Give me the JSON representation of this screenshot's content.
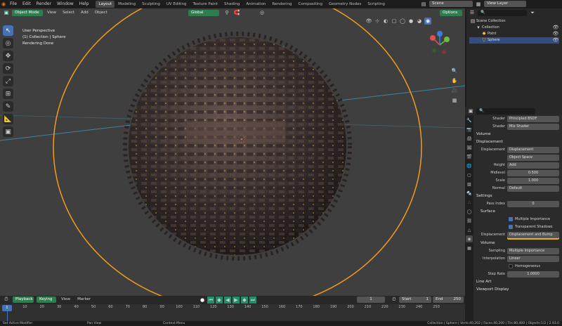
{
  "menubar": {
    "items": [
      "File",
      "Edit",
      "Render",
      "Window",
      "Help"
    ],
    "workspaces": [
      "Layout",
      "Modeling",
      "Sculpting",
      "UV Editing",
      "Texture Paint",
      "Shading",
      "Animation",
      "Rendering",
      "Compositing",
      "Geometry Nodes",
      "Scripting"
    ],
    "active_workspace": "Layout",
    "scene": "Scene",
    "view_layer": "View Layer"
  },
  "viewport_header": {
    "mode": "Object Mode",
    "menus": [
      "View",
      "Select",
      "Add",
      "Object"
    ],
    "transform_orientation": "Global",
    "options": "Options"
  },
  "viewport_info": {
    "line1": "User Perspective",
    "line2": "(1) Collection | Sphere",
    "line3": "Rendering Done"
  },
  "outliner": {
    "rows": [
      {
        "label": "Scene Collection",
        "indent": 0
      },
      {
        "label": "Collection",
        "indent": 1
      },
      {
        "label": "Point",
        "indent": 2
      },
      {
        "label": "Sphere",
        "indent": 2,
        "selected": true
      }
    ]
  },
  "properties": {
    "shader_rows": [
      {
        "label": "Shader",
        "value": "Principled BSDF"
      },
      {
        "label": "Shader",
        "value": "Mix Shader"
      }
    ],
    "volume_label": "Volume",
    "displacement_section": "Displacement",
    "displacement_rows": [
      {
        "label": "Displacement",
        "value": "Displacement",
        "style": "teal"
      },
      {
        "label": "",
        "value": "Object Space",
        "style": "teal"
      },
      {
        "label": "Height",
        "value": "Add",
        "style": "teal"
      },
      {
        "label": "Midlevel",
        "value": "0.500",
        "style": "gray"
      },
      {
        "label": "Scale",
        "value": "1.000",
        "style": "gray"
      },
      {
        "label": "Normal",
        "value": "Default",
        "style": "teal"
      }
    ],
    "settings_section": "Settings",
    "pass_index_label": "Pass Index",
    "pass_index_value": "0",
    "surface_section": "Surface",
    "multiple_importance": "Multiple Importance",
    "transparent_shadows": "Transparent Shadows",
    "surface_displacement_label": "Displacement",
    "surface_displacement_value": "Displacement and Bump",
    "volume_section": "Volume",
    "sampling_label": "Sampling",
    "sampling_value": "Multiple Importance",
    "interpolation_label": "Interpolation",
    "interpolation_value": "Linear",
    "homogeneous": "Homogeneous",
    "step_rate_label": "Step Rate",
    "step_rate_value": "1.0000",
    "line_art": "Line Art",
    "viewport_display": "Viewport Display"
  },
  "timeline": {
    "playback": "Playback",
    "keying": "Keying",
    "view": "View",
    "marker": "Marker",
    "current_frame": "1",
    "start_label": "Start",
    "start_value": "1",
    "end_label": "End",
    "end_value": "250",
    "ticks": [
      "1",
      "10",
      "20",
      "30",
      "40",
      "50",
      "60",
      "70",
      "80",
      "90",
      "100",
      "110",
      "120",
      "130",
      "140",
      "150",
      "160",
      "170",
      "180",
      "190",
      "200",
      "210",
      "220",
      "230",
      "240",
      "250"
    ]
  },
  "statusbar": {
    "left1": "Set Active Modifier",
    "left2": "Pan View",
    "left3": "Context Menu",
    "right": "Collection | Sphere | Verts:40,202 | Faces:40,200 | Tris:80,400 | Objects:1/2 | 2.93.0"
  },
  "colors": {
    "accent_blue": "#4772b3",
    "active_green": "#2e7d4f",
    "teal_field": "#1f8f6a",
    "light_ring": "#f39a1e",
    "yellow_cursor": "#e6b800"
  }
}
